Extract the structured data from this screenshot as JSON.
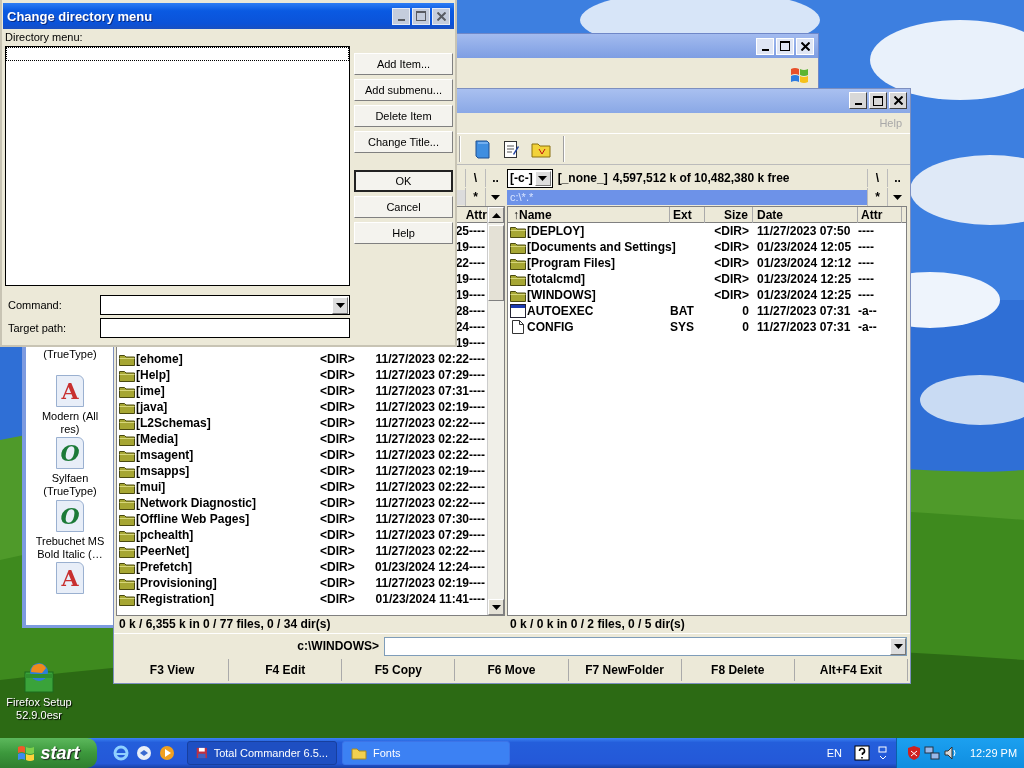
{
  "dialog": {
    "title": "Change directory menu",
    "list_label": "Directory menu:",
    "buttons": [
      {
        "label": "Add Item...",
        "default": false,
        "kind": "edit"
      },
      {
        "label": "Add submenu...",
        "default": false,
        "kind": "edit"
      },
      {
        "label": "Delete Item",
        "default": false,
        "kind": "edit"
      },
      {
        "label": "Change Title...",
        "default": false,
        "kind": "edit"
      },
      {
        "label": "OK",
        "default": true,
        "kind": "close"
      },
      {
        "label": "Cancel",
        "default": false,
        "kind": "close"
      },
      {
        "label": "Help",
        "default": false,
        "kind": "close"
      }
    ],
    "command_label": "Command:",
    "target_label": "Target path:"
  },
  "fonts_window": {
    "items": [
      {
        "label": "(TrueType)"
      },
      {
        "glyph": "A",
        "label": "Modern (All res)"
      },
      {
        "glyph": "O",
        "label": "Sylfaen (TrueType)"
      },
      {
        "glyph": "O",
        "label": "Trebuchet MS Bold Italic (…"
      },
      {
        "glyph": "A"
      }
    ]
  },
  "total_commander": {
    "menu": [
      {
        "label": "Help",
        "disabled": true
      }
    ],
    "left_panel": {
      "root": "\\",
      "parent": "..",
      "filter": "*",
      "active": false,
      "columns": [
        {
          "label": "Attr",
          "kind": "attr"
        }
      ],
      "rows": [
        {
          "kind": "covered",
          "date": "25",
          "attr": "----"
        },
        {
          "kind": "covered",
          "date": "19",
          "attr": "----"
        },
        {
          "kind": "covered",
          "date": "22",
          "attr": "----"
        },
        {
          "kind": "covered",
          "date": "19",
          "attr": "----"
        },
        {
          "kind": "covered",
          "date": "19",
          "attr": "----"
        },
        {
          "kind": "covered",
          "date": "28",
          "attr": "----"
        },
        {
          "kind": "covered",
          "date": "24",
          "attr": "----"
        },
        {
          "kind": "covered",
          "date": "19",
          "attr": "----"
        },
        {
          "kind": "dir",
          "name": "[ehome]",
          "size": "<DIR>",
          "date": "11/27/2023 02:22",
          "attr": "----"
        },
        {
          "kind": "dir",
          "name": "[Help]",
          "size": "<DIR>",
          "date": "11/27/2023 07:29",
          "attr": "----"
        },
        {
          "kind": "dir",
          "name": "[ime]",
          "size": "<DIR>",
          "date": "11/27/2023 07:31",
          "attr": "----"
        },
        {
          "kind": "dir",
          "name": "[java]",
          "size": "<DIR>",
          "date": "11/27/2023 02:19",
          "attr": "----"
        },
        {
          "kind": "dir",
          "name": "[L2Schemas]",
          "size": "<DIR>",
          "date": "11/27/2023 02:22",
          "attr": "----"
        },
        {
          "kind": "dir",
          "name": "[Media]",
          "size": "<DIR>",
          "date": "11/27/2023 02:22",
          "attr": "----"
        },
        {
          "kind": "dir",
          "name": "[msagent]",
          "size": "<DIR>",
          "date": "11/27/2023 02:22",
          "attr": "----"
        },
        {
          "kind": "dir",
          "name": "[msapps]",
          "size": "<DIR>",
          "date": "11/27/2023 02:19",
          "attr": "----"
        },
        {
          "kind": "dir",
          "name": "[mui]",
          "size": "<DIR>",
          "date": "11/27/2023 02:22",
          "attr": "----"
        },
        {
          "kind": "dir",
          "name": "[Network Diagnostic]",
          "size": "<DIR>",
          "date": "11/27/2023 02:22",
          "attr": "----"
        },
        {
          "kind": "dir",
          "name": "[Offline Web Pages]",
          "size": "<DIR>",
          "date": "11/27/2023 07:30",
          "attr": "----"
        },
        {
          "kind": "dir",
          "name": "[pchealth]",
          "size": "<DIR>",
          "date": "11/27/2023 07:29",
          "attr": "----"
        },
        {
          "kind": "dir",
          "name": "[PeerNet]",
          "size": "<DIR>",
          "date": "11/27/2023 02:22",
          "attr": "----"
        },
        {
          "kind": "dir",
          "name": "[Prefetch]",
          "size": "<DIR>",
          "date": "01/23/2024 12:24",
          "attr": "----"
        },
        {
          "kind": "dir",
          "name": "[Provisioning]",
          "size": "<DIR>",
          "date": "11/27/2023 02:19",
          "attr": "----"
        },
        {
          "kind": "dir",
          "name": "[Registration]",
          "size": "<DIR>",
          "date": "01/23/2024 11:41",
          "attr": "----"
        }
      ],
      "status": "0 k / 6,355 k in 0 / 77 files, 0 / 34 dir(s)"
    },
    "right_panel": {
      "drive": "[-c-]",
      "volume": "[_none_]",
      "free": "4,597,512 k of 10,482,380 k free",
      "root": "\\",
      "parent": "..",
      "path": "c:\\*.*",
      "filter": "*",
      "active": true,
      "columns": [
        {
          "label": "↑Name",
          "kind": "name"
        },
        {
          "label": "Ext",
          "kind": "ext"
        },
        {
          "label": "Size",
          "kind": "size"
        },
        {
          "label": "Date",
          "kind": "date"
        },
        {
          "label": "Attr",
          "kind": "attr"
        }
      ],
      "rows": [
        {
          "kind": "dir",
          "name": "[DEPLOY]",
          "size": "<DIR>",
          "date": "11/27/2023 07:50",
          "attr": "----"
        },
        {
          "kind": "dir",
          "name": "[Documents and Settings]",
          "size": "<DIR>",
          "date": "01/23/2024 12:05",
          "attr": "----"
        },
        {
          "kind": "dir",
          "name": "[Program Files]",
          "size": "<DIR>",
          "date": "01/23/2024 12:12",
          "attr": "----"
        },
        {
          "kind": "dir",
          "name": "[totalcmd]",
          "size": "<DIR>",
          "date": "01/23/2024 12:25",
          "attr": "----"
        },
        {
          "kind": "dir",
          "name": "[WINDOWS]",
          "size": "<DIR>",
          "date": "01/23/2024 12:25",
          "attr": "----"
        },
        {
          "kind": "batch",
          "name": "AUTOEXEC",
          "ext": "BAT",
          "size": "0",
          "date": "11/27/2023 07:31",
          "attr": "-a--"
        },
        {
          "kind": "file",
          "name": "CONFIG",
          "ext": "SYS",
          "size": "0",
          "date": "11/27/2023 07:31",
          "attr": "-a--"
        }
      ],
      "status": "0 k / 0 k in 0 / 2 files, 0 / 5 dir(s)"
    },
    "command_prompt": "c:\\WINDOWS>",
    "function_keys": [
      "F3 View",
      "F4 Edit",
      "F5 Copy",
      "F6 Move",
      "F7 NewFolder",
      "F8 Delete",
      "Alt+F4 Exit"
    ]
  },
  "desktop_icons": [
    {
      "label": "Firefox Setup 52.9.0esr"
    }
  ],
  "taskbar": {
    "start": "start",
    "tasks": [
      {
        "label": "Total Commander 6.5...",
        "selected": true,
        "kind": "disk"
      },
      {
        "label": "Fonts",
        "selected": false,
        "kind": "folder"
      }
    ],
    "language": "EN",
    "clock": "12:29 PM"
  }
}
